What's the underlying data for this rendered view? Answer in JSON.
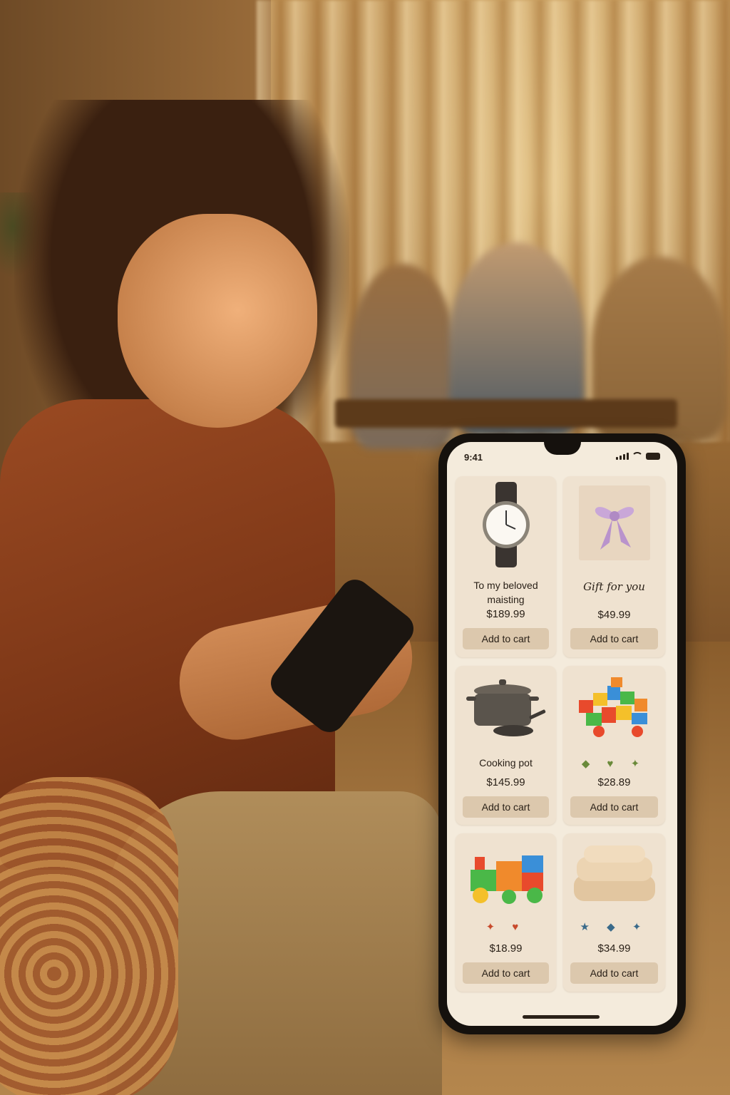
{
  "status_bar": {
    "time": "9:41"
  },
  "products": [
    {
      "name_line1": "To my beloved",
      "name_line2": "maisting",
      "price": "$189.99",
      "button": "Add to cart",
      "icon": "watch-icon"
    },
    {
      "caption": "Gift for you",
      "price": "$49.99",
      "button": "Add to cart",
      "icon": "gift-box-icon"
    },
    {
      "name_line1": "Cooking pot",
      "price": "$145.99",
      "button": "Add to cart",
      "icon": "cooking-pot-icon"
    },
    {
      "glyphs": "◆ ♥ ✦",
      "price": "$28.89",
      "button": "Add to cart",
      "icon": "building-blocks-icon"
    },
    {
      "glyphs": "✦ ♥",
      "price": "$18.99",
      "button": "Add to cart",
      "icon": "toy-train-icon"
    },
    {
      "glyphs": "★ ◆ ✦",
      "price": "$34.99",
      "button": "Add to cart",
      "icon": "folded-towel-icon"
    }
  ],
  "colors": {
    "screen_bg": "#f4ebdc",
    "card_bg": "#efe2d0",
    "button_bg": "#dcc8ad",
    "text": "#2a2118"
  }
}
